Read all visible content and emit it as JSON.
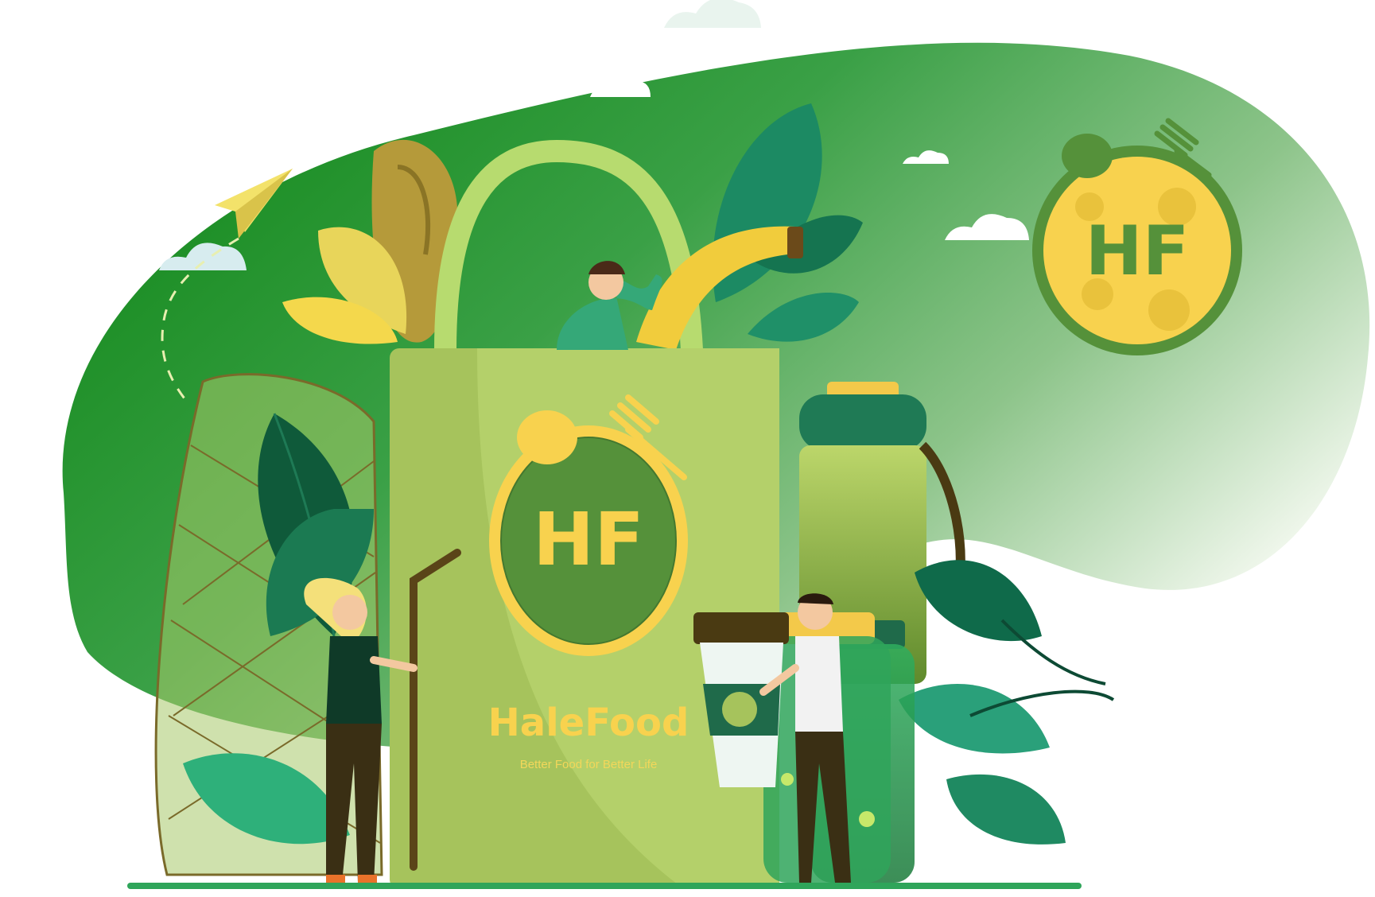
{
  "brand": {
    "name": "HaleFood",
    "tagline": "Better Food for Better Life",
    "monogram": "HF"
  },
  "icons": {
    "paper_plane": "paper-plane-icon",
    "spoon": "spoon-icon",
    "fork": "fork-icon"
  },
  "colors": {
    "blob_dark": "#0b8412",
    "blob_light": "#eef6ea",
    "bag": "#a6c35c",
    "bag_handle": "#b7db6f",
    "logo_yellow": "#f8d24e",
    "logo_green": "#55913a",
    "leaf_dark": "#0f6a4a",
    "leaf_mid": "#2aa07a"
  }
}
